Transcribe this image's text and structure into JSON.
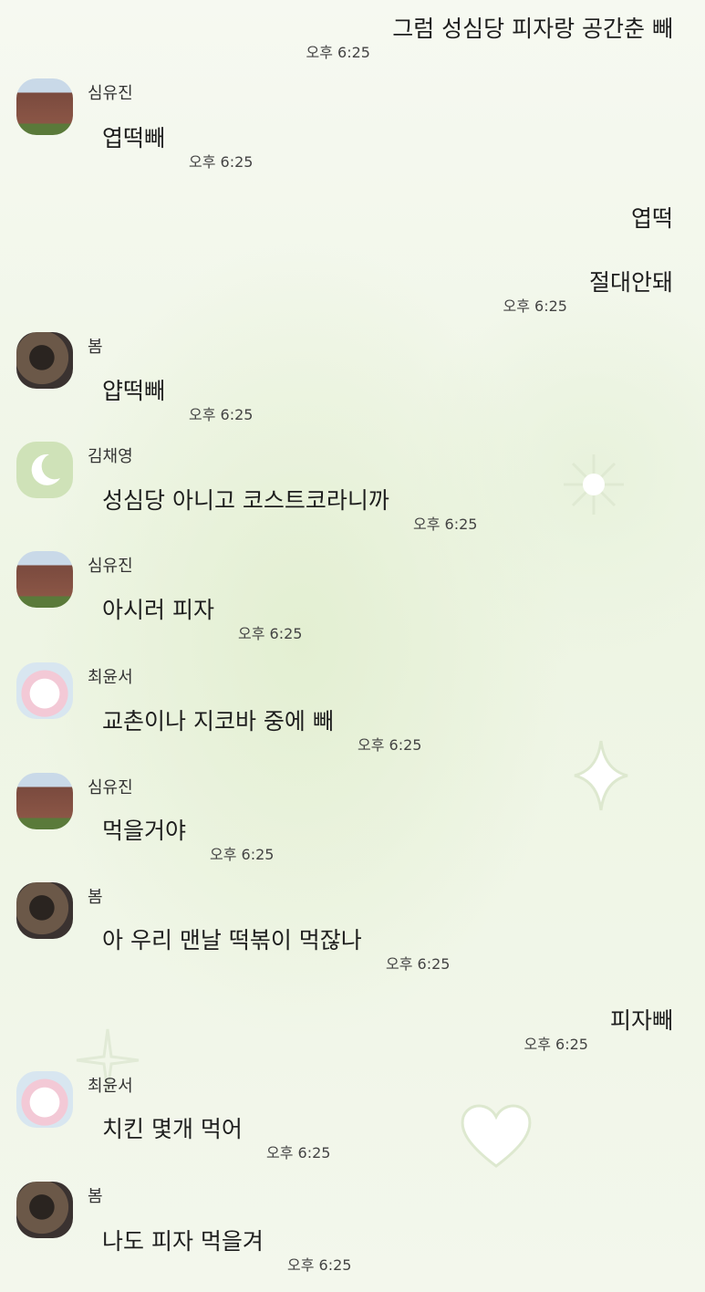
{
  "messages": [
    {
      "dir": "out",
      "text": "그럼 성심당 피자랑 공간춘 빼",
      "time": "오후 6:25"
    },
    {
      "dir": "in",
      "sender": "심유진",
      "avatar": "church-photo",
      "text": "엽떡빼",
      "time": "오후 6:25"
    },
    {
      "dir": "out",
      "text": "엽떡",
      "time": ""
    },
    {
      "dir": "out",
      "text": "절대안돼",
      "time": "오후 6:25"
    },
    {
      "dir": "in",
      "sender": "봄",
      "avatar": "selfie-photo",
      "text": "얍떡빼",
      "time": "오후 6:25"
    },
    {
      "dir": "in",
      "sender": "김채영",
      "avatar": "moon-icon",
      "text": "성심당 아니고 코스트코라니까",
      "time": "오후 6:25"
    },
    {
      "dir": "in",
      "sender": "심유진",
      "avatar": "church-photo",
      "text": "아시러 피자",
      "time": "오후 6:25"
    },
    {
      "dir": "in",
      "sender": "최윤서",
      "avatar": "cake-photo",
      "text": "교촌이나 지코바 중에 빼",
      "time": "오후 6:25"
    },
    {
      "dir": "in",
      "sender": "심유진",
      "avatar": "church-photo",
      "text": "먹을거야",
      "time": "오후 6:25"
    },
    {
      "dir": "in",
      "sender": "봄",
      "avatar": "selfie-photo",
      "text": "아 우리 맨날 떡볶이 먹잖나",
      "time": "오후 6:25"
    },
    {
      "dir": "out",
      "text": "피자빼",
      "time": "오후 6:25"
    },
    {
      "dir": "in",
      "sender": "최윤서",
      "avatar": "cake-photo",
      "text": "치킨 몇개 먹어",
      "time": "오후 6:25"
    },
    {
      "dir": "in",
      "sender": "봄",
      "avatar": "selfie-photo",
      "text": "나도 피자 먹을겨",
      "time": "오후 6:25"
    }
  ],
  "colors": {
    "outgoing_bubble": "#cfe1b9",
    "incoming_bubble": "#ffffff",
    "background": "#f4f8ec"
  }
}
